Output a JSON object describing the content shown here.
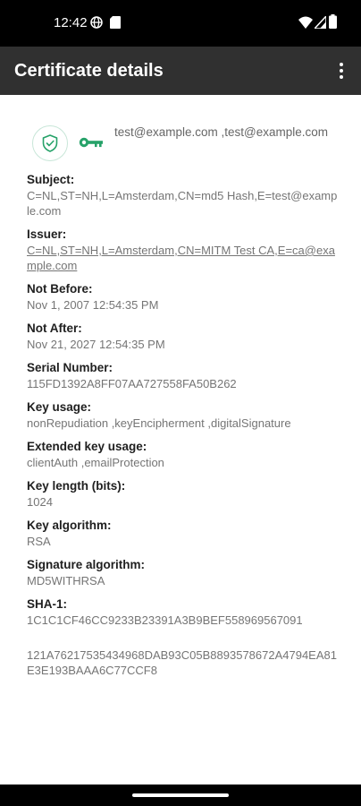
{
  "status_bar": {
    "time": "12:42",
    "icons": [
      "globe-icon",
      "sd-card-icon",
      "wifi-icon",
      "signal-icon",
      "battery-icon"
    ]
  },
  "app_bar": {
    "title": "Certificate details",
    "menu_icon": "more-vert-icon"
  },
  "certificate": {
    "emails": "test@example.com ,test@example.com",
    "badge_icon": "shield-check-icon",
    "key_icon": "key-icon",
    "colors": {
      "accent": "#26a269",
      "title_bar": "#303030",
      "label": "#202020",
      "value": "#757575"
    },
    "fields": [
      {
        "label": "Subject:",
        "value": "C=NL,ST=NH,L=Amsterdam,CN=md5 Hash,E=test@example.com"
      },
      {
        "label": "Issuer:",
        "value": "C=NL,ST=NH,L=Amsterdam,CN=MITM Test CA,E=ca@example.com"
      },
      {
        "label": "Not Before:",
        "value": "Nov 1, 2007 12:54:35 PM"
      },
      {
        "label": "Not After:",
        "value": "Nov 21, 2027 12:54:35 PM"
      },
      {
        "label": "Serial Number:",
        "value": "115FD1392A8FF07AA727558FA50B262"
      },
      {
        "label": "Key usage:",
        "value": "nonRepudiation ,keyEncipherment ,digitalSignature"
      },
      {
        "label": "Extended key usage:",
        "value": "clientAuth ,emailProtection"
      },
      {
        "label": "Key length (bits):",
        "value": "1024"
      },
      {
        "label": "Key algorithm:",
        "value": "RSA"
      },
      {
        "label": "Signature algorithm:",
        "value": "MD5WITHRSA"
      },
      {
        "label": "SHA-1:",
        "value": "1C1C1CF46CC9233B23391A3B9BEF558969567091"
      }
    ],
    "extra_hash": "121A76217535434968DAB93C05B8893578672A4794EA81E3E193BAAA6C77CCF8"
  }
}
